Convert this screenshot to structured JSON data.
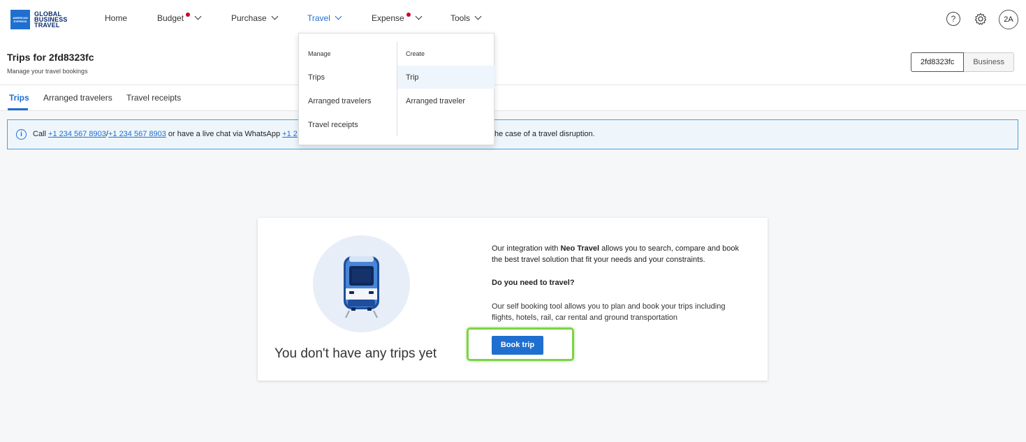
{
  "logo": {
    "box_text": "AMERICAN EXPRESS",
    "line1": "GLOBAL",
    "line2": "BUSINESS",
    "line3": "TRAVEL"
  },
  "nav": {
    "items": [
      {
        "label": "Home",
        "has_chevron": false,
        "has_dot": false
      },
      {
        "label": "Budget",
        "has_chevron": true,
        "has_dot": true
      },
      {
        "label": "Purchase",
        "has_chevron": true,
        "has_dot": false
      },
      {
        "label": "Travel",
        "has_chevron": true,
        "has_dot": false,
        "active": true
      },
      {
        "label": "Expense",
        "has_chevron": true,
        "has_dot": true
      },
      {
        "label": "Tools",
        "has_chevron": true,
        "has_dot": false
      }
    ],
    "help_icon": "?",
    "avatar": "2A"
  },
  "header": {
    "title": "Trips for 2fd8323fc",
    "subtitle": "Manage your travel bookings",
    "accounts": [
      "2fd8323fc",
      "Business"
    ]
  },
  "tabs": [
    "Trips",
    "Arranged travelers",
    "Travel receipts"
  ],
  "banner": {
    "prefix": "Call ",
    "phone1": "+1 234 567 8903",
    "sep": "/",
    "phone2": "+1 234 567 8903",
    "mid": " or have a live chat via WhatsApp ",
    "phone3": "+1 2",
    "tail": "he case of a travel disruption."
  },
  "dropdown": {
    "manage_heading": "Manage",
    "manage_items": [
      "Trips",
      "Arranged travelers",
      "Travel receipts"
    ],
    "create_heading": "Create",
    "create_items": [
      "Trip",
      "Arranged traveler"
    ]
  },
  "empty_state": {
    "title": "You don't have any trips yet",
    "desc1_pre": "Our integration with ",
    "desc1_bold": "Neo Travel",
    "desc1_post": " allows you to search, compare and book the best travel solution that fit your needs and your constraints.",
    "question": "Do you need to travel?",
    "desc2": "Our self booking tool allows you to plan and book your trips including flights, hotels, rail, car rental and ground transportation",
    "button": "Book trip"
  },
  "colors": {
    "accent": "#1f6fd0",
    "notification": "#d0021b",
    "highlight": "#7ed348"
  }
}
